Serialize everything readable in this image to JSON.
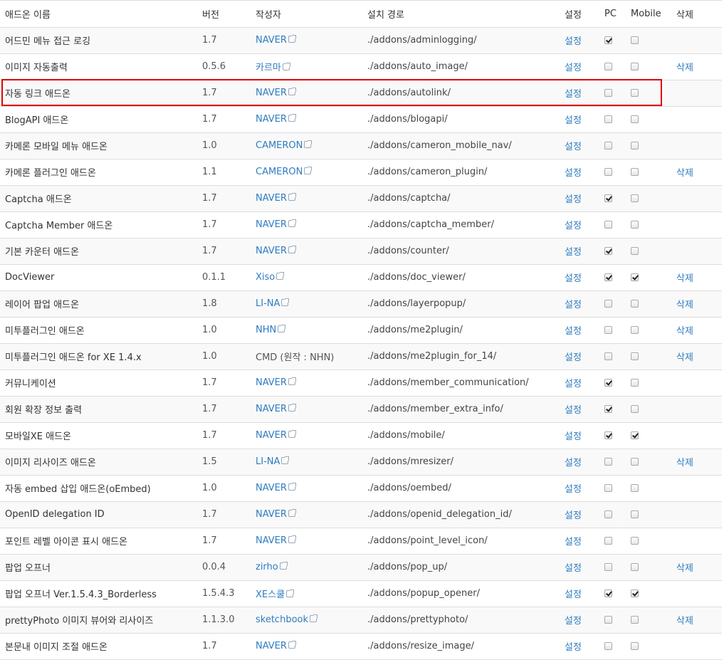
{
  "colors": {
    "link": "#2f7cc1",
    "highlight": "#e00000",
    "stripe": "#f9f9f9",
    "border": "#dddddd"
  },
  "headers": {
    "name": "애드온 이름",
    "version": "버전",
    "author": "작성자",
    "path": "설치 경로",
    "settings": "설정",
    "pc": "PC",
    "mobile": "Mobile",
    "delete": "삭제"
  },
  "labels": {
    "settings": "설정",
    "delete": "삭제"
  },
  "highlighted_row": 2,
  "rows": [
    {
      "name": "어드민 메뉴 접근 로깅",
      "version": "1.7",
      "author": "NAVER",
      "author_link": true,
      "path": "./addons/adminlogging/",
      "pc": true,
      "mobile": false,
      "deletable": false
    },
    {
      "name": "이미지 자동출력",
      "version": "0.5.6",
      "author": "카르마",
      "author_link": true,
      "path": "./addons/auto_image/",
      "pc": false,
      "mobile": false,
      "deletable": true
    },
    {
      "name": "자동 링크 애드온",
      "version": "1.7",
      "author": "NAVER",
      "author_link": true,
      "path": "./addons/autolink/",
      "pc": false,
      "mobile": false,
      "deletable": false
    },
    {
      "name": "BlogAPI 애드온",
      "version": "1.7",
      "author": "NAVER",
      "author_link": true,
      "path": "./addons/blogapi/",
      "pc": false,
      "mobile": false,
      "deletable": false
    },
    {
      "name": "카메론 모바일 메뉴 애드온",
      "version": "1.0",
      "author": "CAMERON",
      "author_link": true,
      "path": "./addons/cameron_mobile_nav/",
      "pc": false,
      "mobile": false,
      "deletable": false
    },
    {
      "name": "카메론 플러그인 애드온",
      "version": "1.1",
      "author": "CAMERON",
      "author_link": true,
      "path": "./addons/cameron_plugin/",
      "pc": false,
      "mobile": false,
      "deletable": true
    },
    {
      "name": "Captcha 애드온",
      "version": "1.7",
      "author": "NAVER",
      "author_link": true,
      "path": "./addons/captcha/",
      "pc": true,
      "mobile": false,
      "deletable": false
    },
    {
      "name": "Captcha Member 애드온",
      "version": "1.7",
      "author": "NAVER",
      "author_link": true,
      "path": "./addons/captcha_member/",
      "pc": false,
      "mobile": false,
      "deletable": false
    },
    {
      "name": "기본 카운터 애드온",
      "version": "1.7",
      "author": "NAVER",
      "author_link": true,
      "path": "./addons/counter/",
      "pc": true,
      "mobile": false,
      "deletable": false
    },
    {
      "name": "DocViewer",
      "version": "0.1.1",
      "author": "Xiso",
      "author_link": true,
      "path": "./addons/doc_viewer/",
      "pc": true,
      "mobile": true,
      "deletable": true
    },
    {
      "name": "레이어 팝업 애드온",
      "version": "1.8",
      "author": "LI-NA",
      "author_link": true,
      "path": "./addons/layerpopup/",
      "pc": false,
      "mobile": false,
      "deletable": true
    },
    {
      "name": "미투플러그인 애드온",
      "version": "1.0",
      "author": "NHN",
      "author_link": true,
      "path": "./addons/me2plugin/",
      "pc": false,
      "mobile": false,
      "deletable": true
    },
    {
      "name": "미투플러그인 애드온 for XE 1.4.x",
      "version": "1.0",
      "author": "CMD (원작 : NHN)",
      "author_link": false,
      "path": "./addons/me2plugin_for_14/",
      "pc": false,
      "mobile": false,
      "deletable": true
    },
    {
      "name": "커뮤니케이션",
      "version": "1.7",
      "author": "NAVER",
      "author_link": true,
      "path": "./addons/member_communication/",
      "pc": true,
      "mobile": false,
      "deletable": false
    },
    {
      "name": "회원 확장 정보 출력",
      "version": "1.7",
      "author": "NAVER",
      "author_link": true,
      "path": "./addons/member_extra_info/",
      "pc": true,
      "mobile": false,
      "deletable": false
    },
    {
      "name": "모바일XE 애드온",
      "version": "1.7",
      "author": "NAVER",
      "author_link": true,
      "path": "./addons/mobile/",
      "pc": true,
      "mobile": true,
      "deletable": false
    },
    {
      "name": "이미지 리사이즈 애드온",
      "version": "1.5",
      "author": "LI-NA",
      "author_link": true,
      "path": "./addons/mresizer/",
      "pc": false,
      "mobile": false,
      "deletable": true
    },
    {
      "name": "자동 embed 삽입 애드온(oEmbed)",
      "version": "1.0",
      "author": "NAVER",
      "author_link": true,
      "path": "./addons/oembed/",
      "pc": false,
      "mobile": false,
      "deletable": false
    },
    {
      "name": "OpenID delegation ID",
      "version": "1.7",
      "author": "NAVER",
      "author_link": true,
      "path": "./addons/openid_delegation_id/",
      "pc": false,
      "mobile": false,
      "deletable": false
    },
    {
      "name": "포인트 레벨 아이콘 표시 애드온",
      "version": "1.7",
      "author": "NAVER",
      "author_link": true,
      "path": "./addons/point_level_icon/",
      "pc": false,
      "mobile": false,
      "deletable": false
    },
    {
      "name": "팝업 오프너",
      "version": "0.0.4",
      "author": "zirho",
      "author_link": true,
      "path": "./addons/pop_up/",
      "pc": false,
      "mobile": false,
      "deletable": true
    },
    {
      "name": "팝업 오프너 Ver.1.5.4.3_Borderless",
      "version": "1.5.4.3",
      "author": "XE스쿨",
      "author_link": true,
      "path": "./addons/popup_opener/",
      "pc": true,
      "mobile": true,
      "deletable": false
    },
    {
      "name": "prettyPhoto 이미지 뷰어와 리사이즈",
      "version": "1.1.3.0",
      "author": "sketchbook",
      "author_link": true,
      "path": "./addons/prettyphoto/",
      "pc": false,
      "mobile": false,
      "deletable": true
    },
    {
      "name": "본문내 이미지 조절 애드온",
      "version": "1.7",
      "author": "NAVER",
      "author_link": true,
      "path": "./addons/resize_image/",
      "pc": false,
      "mobile": false,
      "deletable": false
    }
  ]
}
